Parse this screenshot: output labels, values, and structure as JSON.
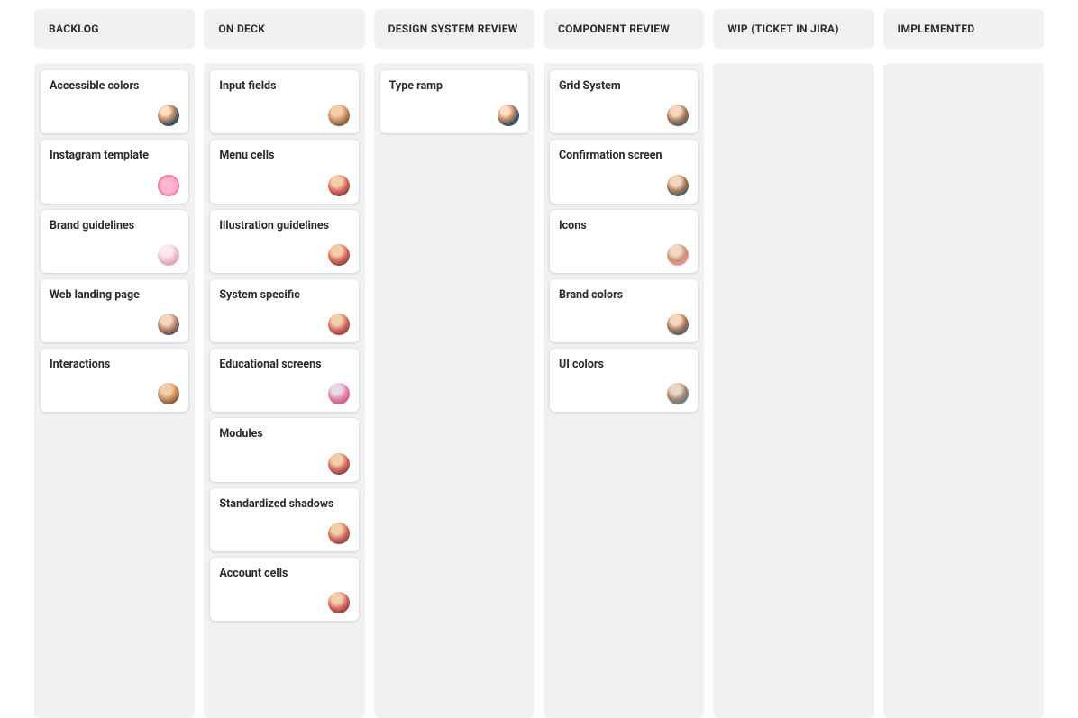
{
  "columns": [
    {
      "id": "backlog",
      "title": "BACKLOG",
      "cards": [
        {
          "title": "Accessible colors",
          "avatar": "av-1"
        },
        {
          "title": "Instagram template",
          "avatar": "av-2"
        },
        {
          "title": "Brand guidelines",
          "avatar": "av-3"
        },
        {
          "title": "Web landing page",
          "avatar": "av-4"
        },
        {
          "title": "Interactions",
          "avatar": "av-5"
        }
      ]
    },
    {
      "id": "on-deck",
      "title": "ON DECK",
      "cards": [
        {
          "title": "Input fields",
          "avatar": "av-5"
        },
        {
          "title": "Menu cells",
          "avatar": "av-6"
        },
        {
          "title": "Illustration guidelines",
          "avatar": "av-6"
        },
        {
          "title": "System specific",
          "avatar": "av-6"
        },
        {
          "title": "Educational screens",
          "avatar": "av-7"
        },
        {
          "title": "Modules",
          "avatar": "av-6"
        },
        {
          "title": "Standardized shadows",
          "avatar": "av-6"
        },
        {
          "title": "Account cells",
          "avatar": "av-6"
        }
      ]
    },
    {
      "id": "design-system-review",
      "title": "DESIGN SYSTEM REVIEW",
      "cards": [
        {
          "title": "Type ramp",
          "avatar": "av-1"
        }
      ]
    },
    {
      "id": "component-review",
      "title": "COMPONENT REVIEW",
      "cards": [
        {
          "title": "Grid System",
          "avatar": "av-9"
        },
        {
          "title": "Confirmation screen",
          "avatar": "av-9"
        },
        {
          "title": "Icons",
          "avatar": "av-8"
        },
        {
          "title": "Brand colors",
          "avatar": "av-9"
        },
        {
          "title": "UI colors",
          "avatar": "av-10"
        }
      ]
    },
    {
      "id": "wip",
      "title": "WIP (TICKET IN JIRA)",
      "cards": []
    },
    {
      "id": "implemented",
      "title": "IMPLEMENTED",
      "cards": []
    }
  ]
}
